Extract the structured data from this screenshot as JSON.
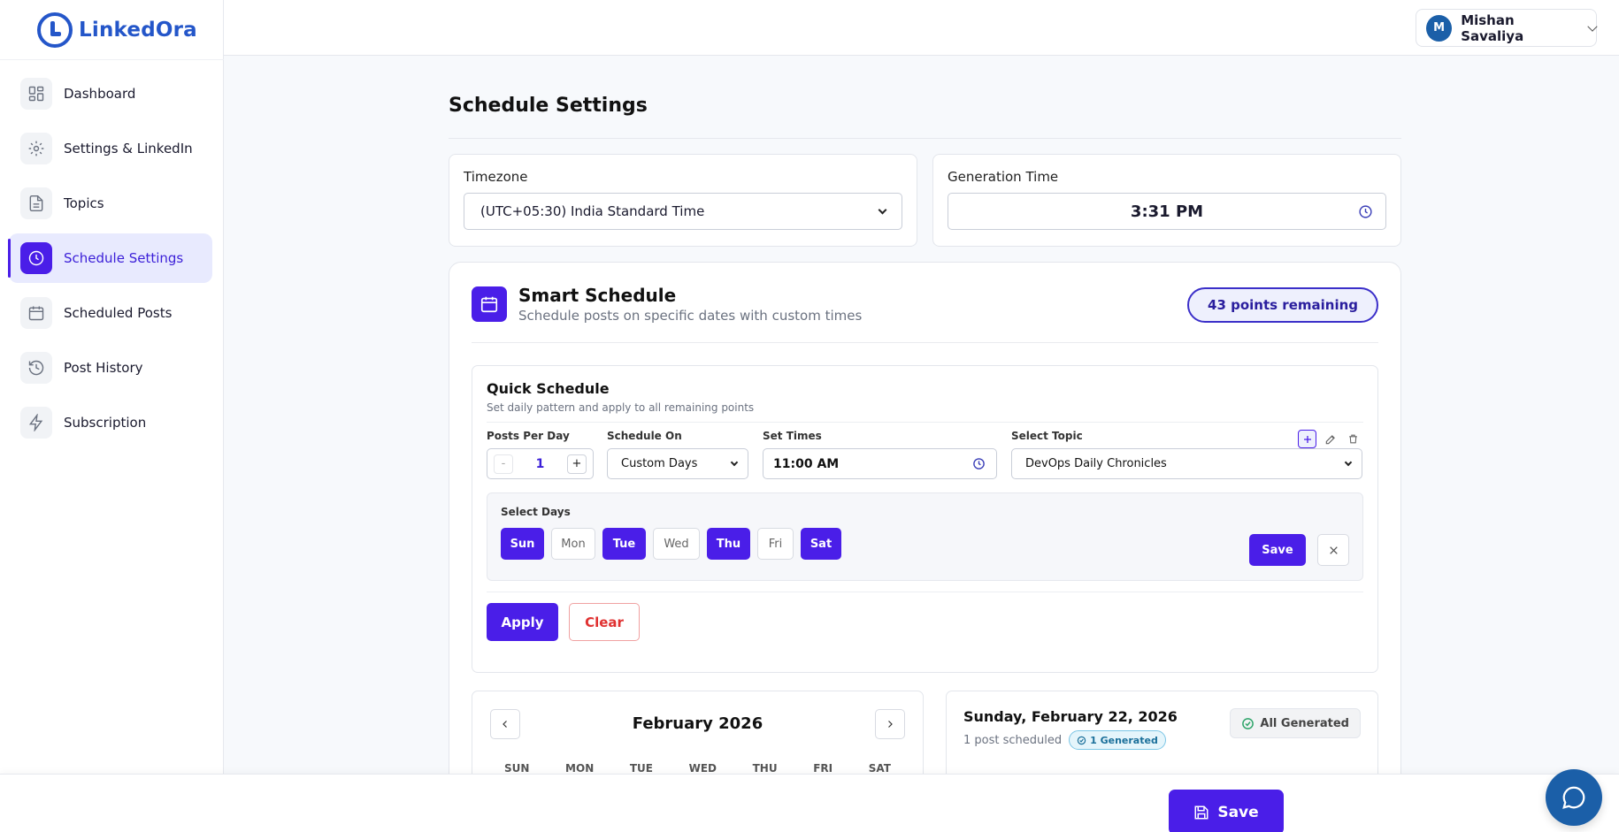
{
  "app": {
    "brand": "LinkedOra"
  },
  "user": {
    "initial": "M",
    "name": "Mishan Savaliya"
  },
  "sidebar": {
    "items": [
      {
        "label": "Dashboard",
        "icon": "grid-icon"
      },
      {
        "label": "Settings & LinkedIn",
        "icon": "gear-icon"
      },
      {
        "label": "Topics",
        "icon": "document-icon"
      },
      {
        "label": "Schedule Settings",
        "icon": "clock-icon",
        "active": true
      },
      {
        "label": "Scheduled Posts",
        "icon": "calendar-icon"
      },
      {
        "label": "Post History",
        "icon": "history-icon"
      },
      {
        "label": "Subscription",
        "icon": "lightning-icon"
      }
    ]
  },
  "page": {
    "title": "Schedule Settings"
  },
  "timezone": {
    "label": "Timezone",
    "value": "(UTC+05:30) India Standard Time"
  },
  "generation": {
    "label": "Generation Time",
    "value": "3:31 PM"
  },
  "smart": {
    "title": "Smart Schedule",
    "subtitle": "Schedule posts on specific dates with custom times",
    "points": "43 points remaining"
  },
  "quick": {
    "title": "Quick Schedule",
    "subtitle": "Set daily pattern and apply to all remaining points",
    "posts_label": "Posts Per Day",
    "posts_value": "1",
    "minus": "-",
    "plus": "+",
    "schedule_label": "Schedule On",
    "schedule_value": "Custom Days",
    "times_label": "Set Times",
    "times_value": "11:00 AM",
    "topic_label": "Select Topic",
    "topic_value": "DevOps Daily Chronicles",
    "days_label": "Select Days",
    "days": [
      {
        "label": "Sun",
        "on": true
      },
      {
        "label": "Mon",
        "on": false
      },
      {
        "label": "Tue",
        "on": true
      },
      {
        "label": "Wed",
        "on": false
      },
      {
        "label": "Thu",
        "on": true
      },
      {
        "label": "Fri",
        "on": false
      },
      {
        "label": "Sat",
        "on": true
      }
    ],
    "days_save": "Save",
    "apply": "Apply",
    "clear": "Clear"
  },
  "calendar": {
    "month": "February 2026",
    "weekdays": [
      "SUN",
      "MON",
      "TUE",
      "WED",
      "THU",
      "FRI",
      "SAT"
    ]
  },
  "dayinfo": {
    "title": "Sunday, February 22, 2026",
    "scheduled": "1 post scheduled",
    "generated": "1 Generated",
    "status": "All Generated"
  },
  "footer": {
    "save": "Save"
  },
  "colors": {
    "accent": "#4a1ee8",
    "brand": "#2456c9",
    "danger": "#e03131"
  }
}
